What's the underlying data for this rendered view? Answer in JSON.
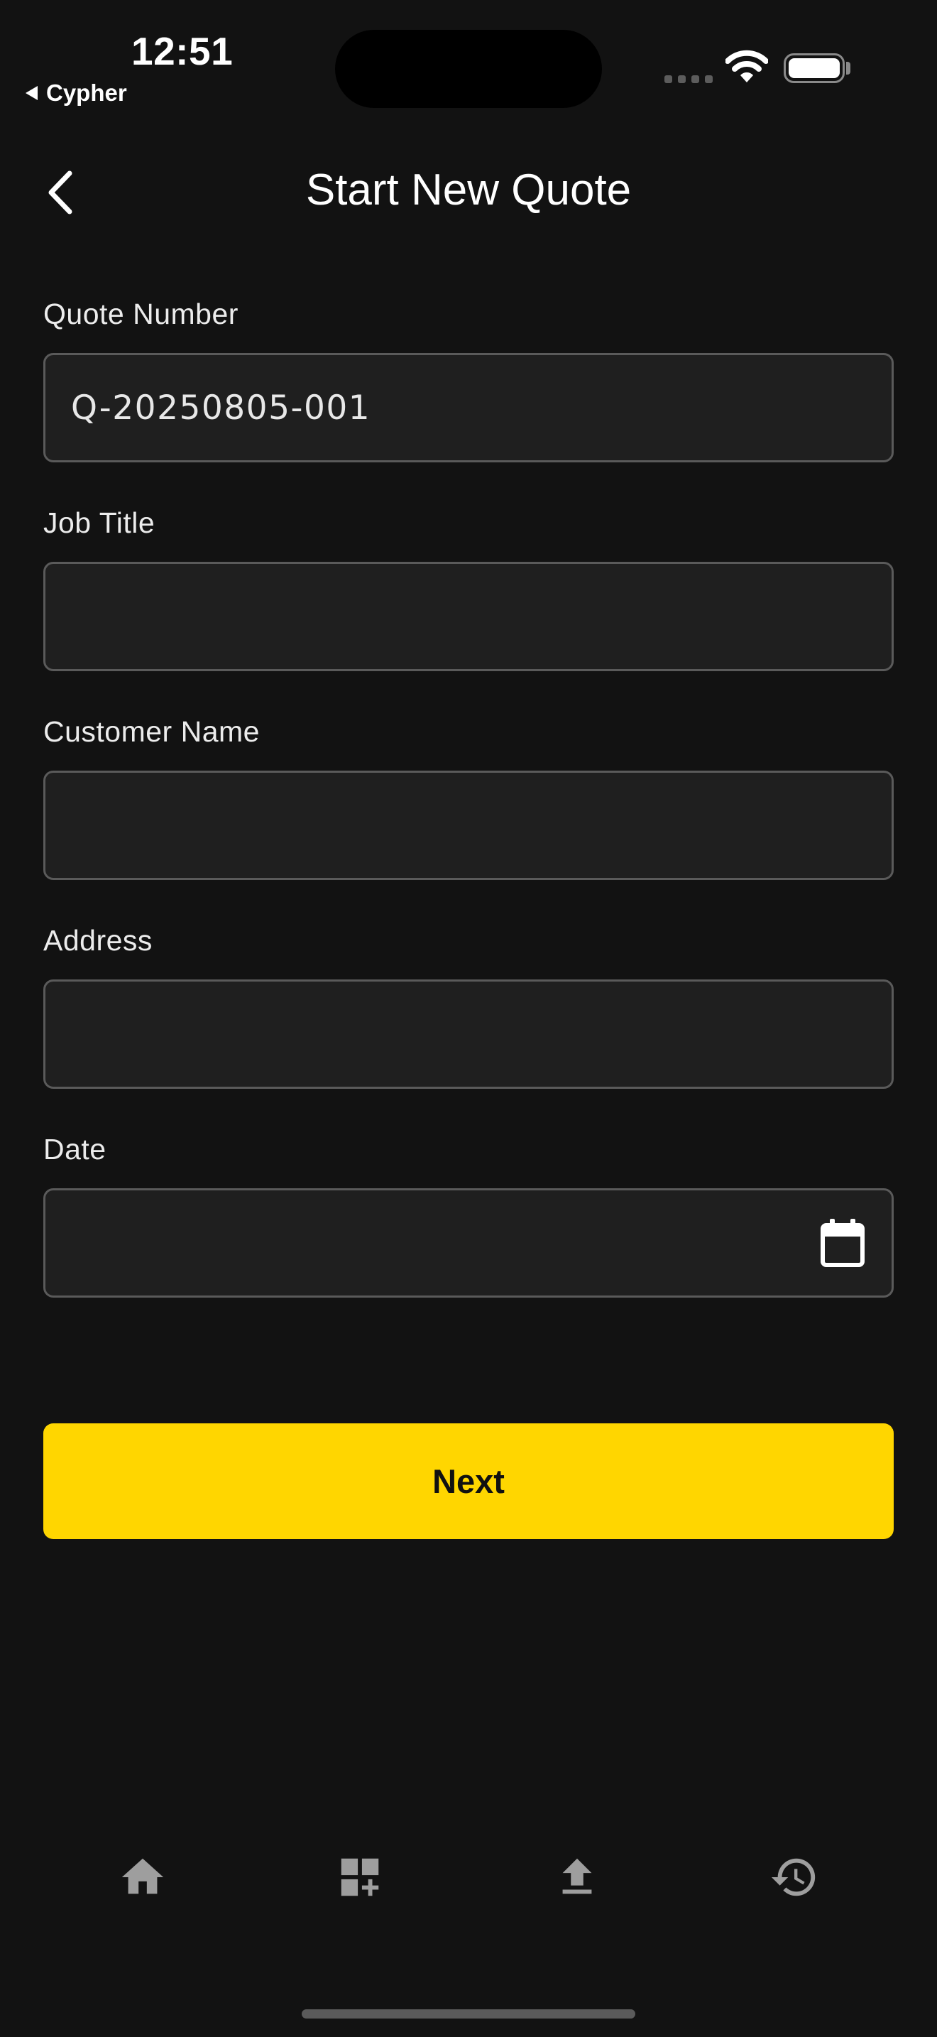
{
  "status_bar": {
    "time": "12:51",
    "back_app": "Cypher"
  },
  "header": {
    "title": "Start New Quote"
  },
  "form": {
    "quote_number": {
      "label": "Quote Number",
      "value": "Q-20250805-001"
    },
    "job_title": {
      "label": "Job Title",
      "value": ""
    },
    "customer_name": {
      "label": "Customer Name",
      "value": ""
    },
    "address": {
      "label": "Address",
      "value": ""
    },
    "date": {
      "label": "Date",
      "value": ""
    }
  },
  "actions": {
    "next_label": "Next"
  },
  "bottom_nav": {
    "tabs": [
      {
        "icon": "home-icon"
      },
      {
        "icon": "add-widget-icon"
      },
      {
        "icon": "upload-icon"
      },
      {
        "icon": "history-icon"
      }
    ]
  },
  "colors": {
    "background": "#121212",
    "accent": "#ffd600",
    "input_bg": "#1f1f1f",
    "input_border": "#5a5a5a",
    "nav_icon": "#9e9e9e"
  }
}
